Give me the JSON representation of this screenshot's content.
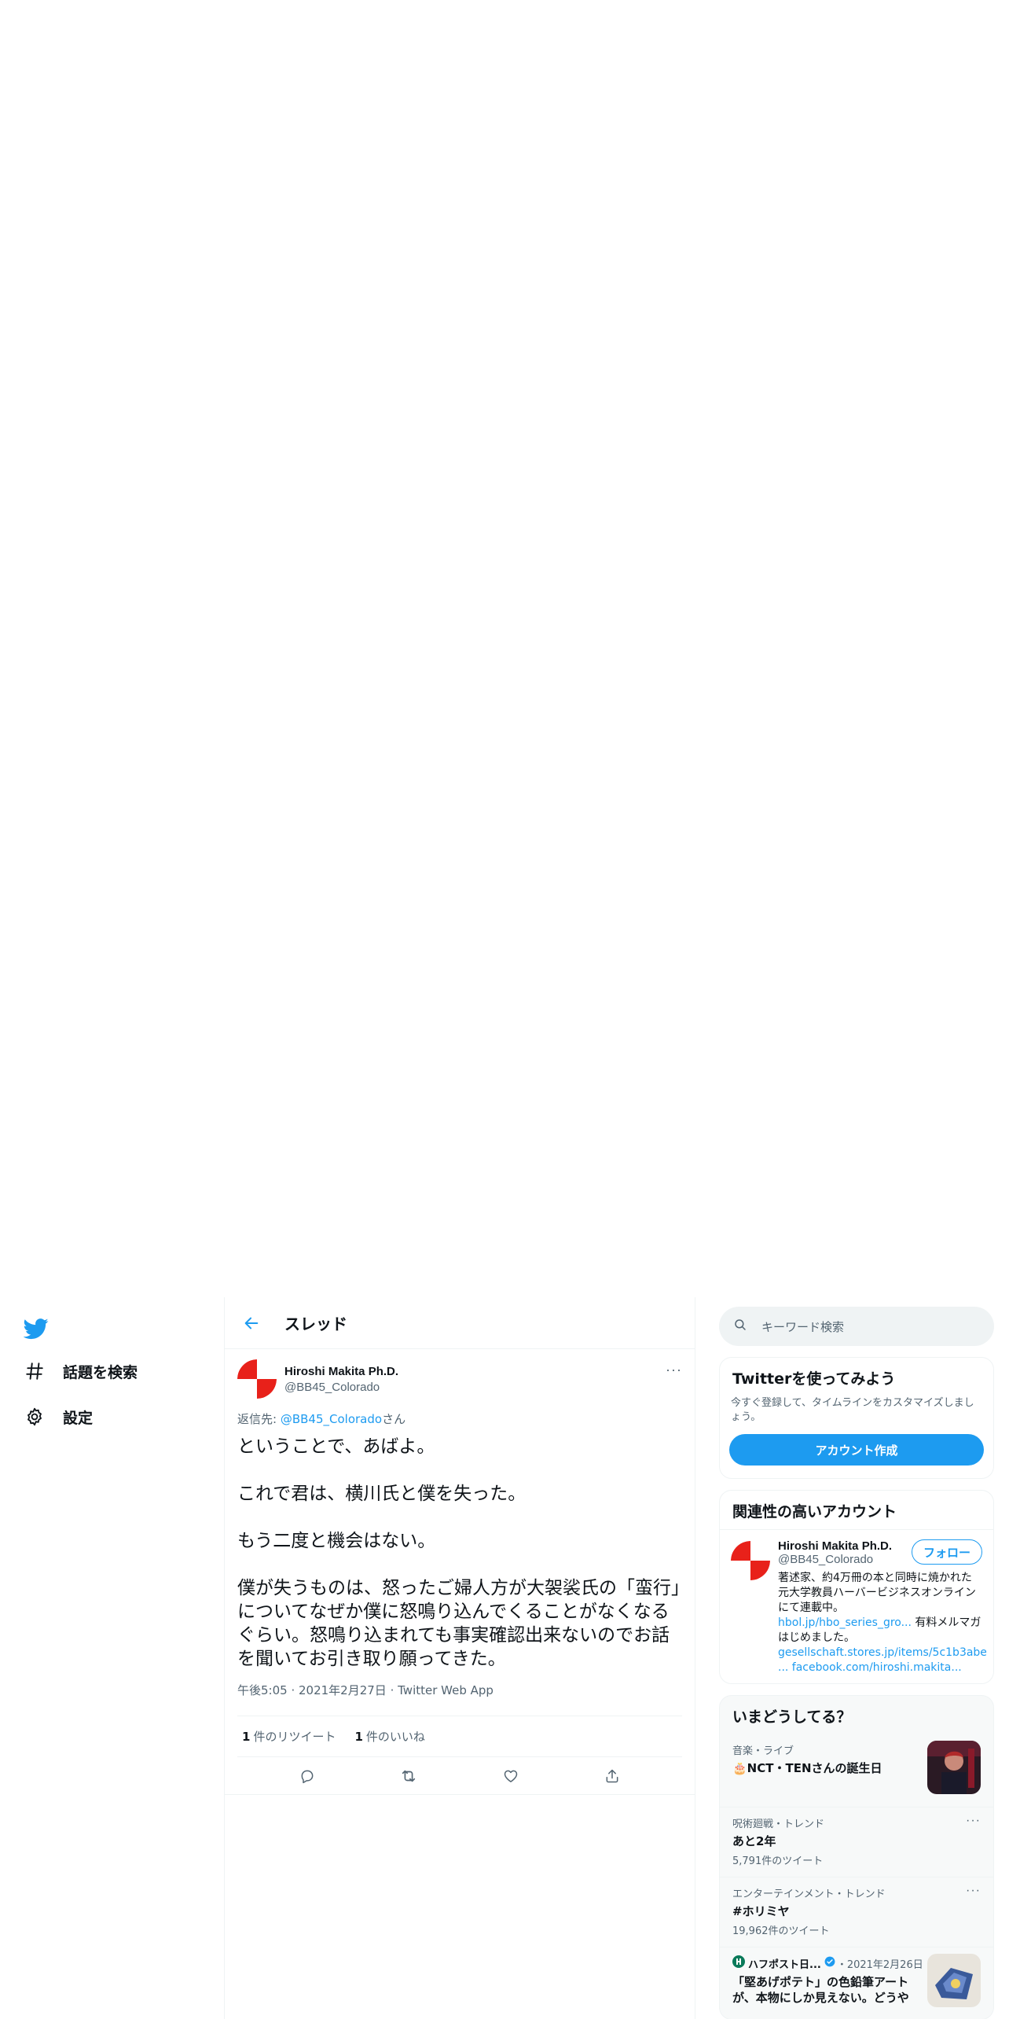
{
  "nav": {
    "items": [
      {
        "label": "話題を検索",
        "icon": "hashtag-icon"
      },
      {
        "label": "設定",
        "icon": "gear-icon"
      }
    ]
  },
  "header": {
    "title": "スレッド"
  },
  "tweet": {
    "author_name": "Hiroshi Makita Ph.D.",
    "author_handle": "@BB45_Colorado",
    "reply_prefix": "返信先: ",
    "reply_handle": "@BB45_Colorado",
    "reply_suffix": "さん",
    "paragraphs": [
      "ということで、あばよ。",
      "これで君は、横川氏と僕を失った。",
      "もう二度と機会はない。",
      "僕が失うものは、怒ったご婦人方が大袈裟氏の「蛮行」についてなぜか僕に怒鳴り込んでくることがなくなるぐらい。怒鳴り込まれても事実確認出来ないのでお話を聞いてお引き取り願ってきた。"
    ],
    "time": "午後5:05",
    "date": "2021年2月27日",
    "app": "Twitter Web App",
    "retweet_count": "1",
    "retweet_label": "件のリツイート",
    "like_count": "1",
    "like_label": "件のいいね"
  },
  "search": {
    "placeholder": "キーワード検索"
  },
  "signup": {
    "title": "Twitterを使ってみよう",
    "desc": "今すぐ登録して、タイムラインをカスタマイズしましょう。",
    "button": "アカウント作成"
  },
  "related": {
    "title": "関連性の高いアカウント",
    "name": "Hiroshi Makita Ph.D.",
    "handle": "@BB45_Colorado",
    "follow": "フォロー",
    "bio": "著述家、約4万冊の本と同時に焼かれた元大学教員ハーバービジネスオンラインにて連載中。",
    "bio_link1": "hbol.jp/hbo_series_gro...",
    "bio_mid": " 有料メルマガはじめました。",
    "bio_link2": "gesellschaft.stores.jp/items/5c1b3abe",
    "bio_link3": "... facebook.com/hiroshi.makita..."
  },
  "trends": {
    "title": "いまどうしてる？",
    "items": [
      {
        "category": "音楽・ライブ",
        "name": "🎂NCT・TENさんの誕生日",
        "count": ""
      },
      {
        "category": "呪術廻戦・トレンド",
        "name": "あと2年",
        "count": "5,791件のツイート"
      },
      {
        "category": "エンターテインメント・トレンド",
        "name": "#ホリミヤ",
        "count": "19,962件のツイート"
      }
    ],
    "news": {
      "source": "ハフポスト日...",
      "date": "・2021年2月26日",
      "title": "「堅あげポテト」の色鉛筆アートが、本物にしか見えない。どうや"
    }
  },
  "colors": {
    "accent": "#1d9bf0",
    "text": "#0f1419",
    "muted": "#536471",
    "border": "#eff3f4"
  }
}
